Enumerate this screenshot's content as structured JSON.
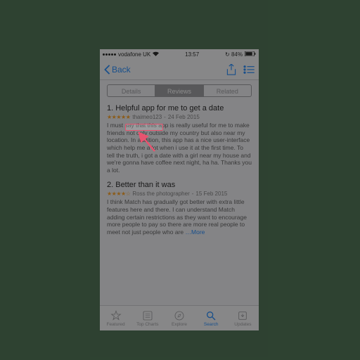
{
  "status": {
    "carrier": "vodafone UK",
    "time": "13:57",
    "battery": "84%"
  },
  "nav": {
    "back": "Back"
  },
  "segments": {
    "details": "Details",
    "reviews": "Reviews",
    "related": "Related"
  },
  "reviews": [
    {
      "title": "1. Helpful app for me to get a date",
      "stars": "★★★★★",
      "author": "thaimeo123",
      "date": "24 Feb 2015",
      "body": "I must say that this app is really useful for me to make friends not only outside my country but also near my location. In addition, this app has a nice user-interface which help me a lot when i use it at the first time. To tell the truth, i got a date with a girl near my house and we're gonna have coffee next night, ha ha. Thanks you a lot."
    },
    {
      "title": "2. Better than it was",
      "stars": "★★★★☆",
      "author": "Ross the photographer",
      "date": "15 Feb 2015",
      "body": "I think Match has gradually got better with extra little features here and there. I can understand Match adding certain restrictions as they want to encourage more people to pay so there are more real people to meet not just people who are",
      "more": "…More"
    }
  ],
  "tabs": {
    "featured": "Featured",
    "topcharts": "Top Charts",
    "explore": "Explore",
    "search": "Search",
    "updates": "Updates"
  },
  "annotation": {
    "highlighted_author": "thaimeo123"
  }
}
